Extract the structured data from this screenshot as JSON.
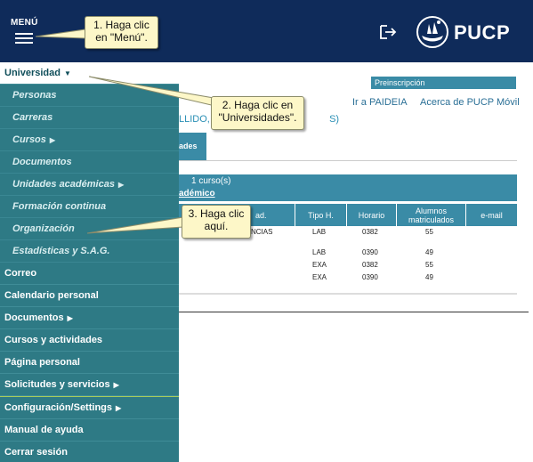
{
  "header": {
    "menu_label": "MENÚ",
    "logo_text": "PUCP"
  },
  "content": {
    "preinscripcion": "Preinscripción",
    "link_paideia": "Ir a PAIDEIA",
    "link_movil": "Acerca de PUCP Móvil",
    "name_fragment": "LLIDO, ...",
    "name_fragment_end": "S)",
    "tab_fragment": "ades",
    "course_count": "1 curso(s)",
    "course_unit": "adémico",
    "table_headers": [
      "ad.",
      "Tipo H.",
      "Horario",
      "Alumnos matriculados",
      "e-mail"
    ],
    "unit_fragment": "NCIAS",
    "rows": [
      {
        "tipo": "LAB",
        "horario": "0382",
        "alumnos": "55"
      },
      {
        "tipo": "LAB",
        "horario": "0390",
        "alumnos": "49"
      },
      {
        "tipo": "EXA",
        "horario": "0382",
        "alumnos": "55"
      },
      {
        "tipo": "EXA",
        "horario": "0390",
        "alumnos": "49"
      }
    ]
  },
  "menu": {
    "items": [
      {
        "label": "Universidad",
        "caret": "▼"
      },
      {
        "label": "Correo"
      },
      {
        "label": "Calendario personal"
      },
      {
        "label": "Documentos",
        "caret": "▶"
      },
      {
        "label": "Cursos y actividades"
      },
      {
        "label": "Página personal"
      },
      {
        "label": "Solicitudes y servicios",
        "caret": "▶"
      },
      {
        "label": "Configuración/Settings",
        "caret": "▶"
      },
      {
        "label": "Manual de ayuda"
      },
      {
        "label": "Cerrar sesión"
      }
    ],
    "submenu": [
      {
        "label": "Personas"
      },
      {
        "label": "Carreras"
      },
      {
        "label": "Cursos",
        "caret": "▶"
      },
      {
        "label": "Documentos"
      },
      {
        "label": "Unidades académicas",
        "caret": "▶"
      },
      {
        "label": "Formación continua"
      },
      {
        "label": "Organización"
      },
      {
        "label": "Estadísticas y S.A.G."
      }
    ]
  },
  "callouts": {
    "c1_line1": "1. Haga clic",
    "c1_line2": "en \"Menú\".",
    "c2_line1": "2. Haga clic en",
    "c2_line2": "\"Universidades\".",
    "c3_line1": "3. Haga clic",
    "c3_line2": "aquí."
  },
  "colors": {
    "header_bg": "#0f2b5a",
    "menu_bg": "#2e7a85",
    "accent": "#3a8ba6",
    "callout_bg": "#fdf7c8"
  },
  "icons": [
    "hamburger-icon",
    "logout-icon",
    "pucp-logo-icon",
    "caret-down-icon",
    "caret-right-icon"
  ]
}
